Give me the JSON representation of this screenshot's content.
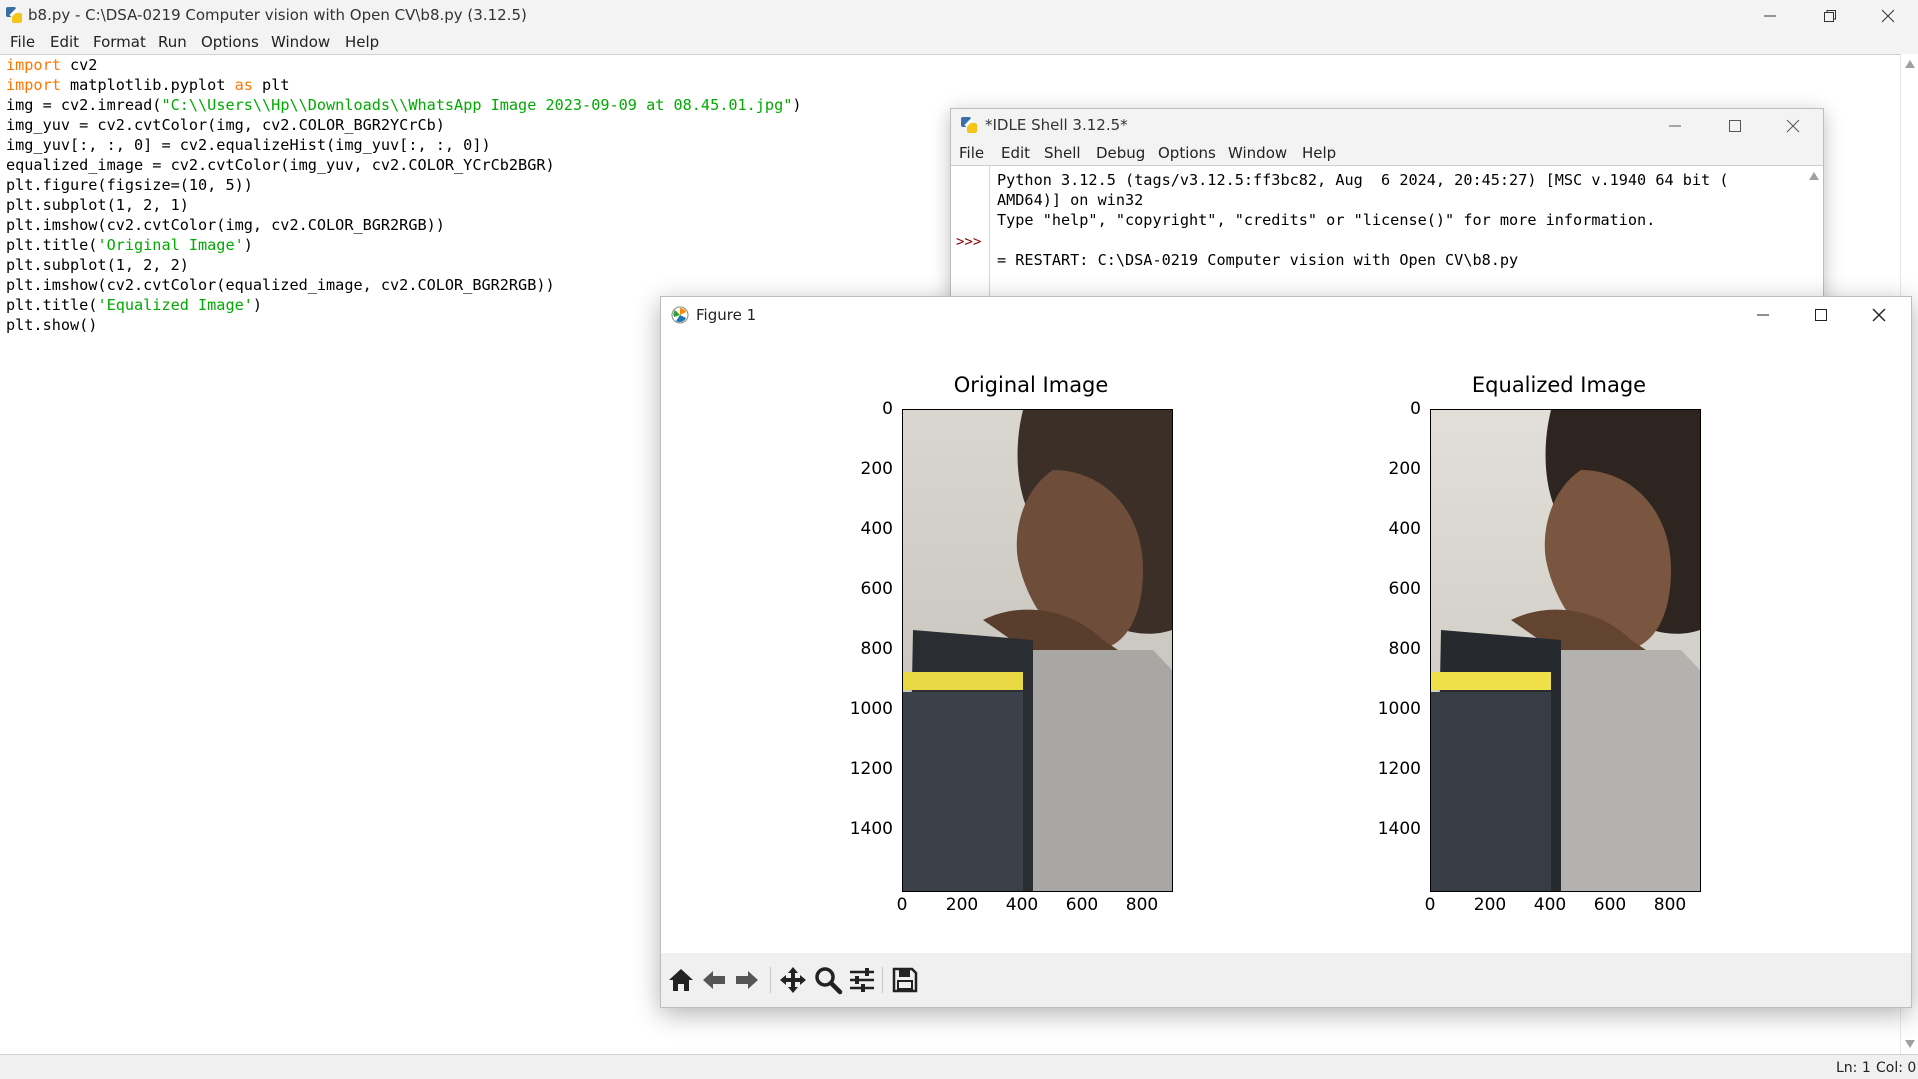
{
  "editor": {
    "title": "b8.py - C:\\DSA-0219 Computer vision with Open CV\\b8.py (3.12.5)",
    "menu": [
      "File",
      "Edit",
      "Format",
      "Run",
      "Options",
      "Window",
      "Help"
    ],
    "code": {
      "l1_kw": "import",
      "l1_rest": " cv2",
      "l2_kw": "import",
      "l2_mid": " matplotlib.pyplot ",
      "l2_kw2": "as",
      "l2_rest": " plt",
      "l3_pre": "img = cv2.imread(",
      "l3_str": "\"C:\\\\Users\\\\Hp\\\\Downloads\\\\WhatsApp Image 2023-09-09 at 08.45.01.jpg\"",
      "l3_post": ")",
      "l4": "img_yuv = cv2.cvtColor(img, cv2.COLOR_BGR2YCrCb)",
      "l5": "img_yuv[:, :, 0] = cv2.equalizeHist(img_yuv[:, :, 0])",
      "l6": "equalized_image = cv2.cvtColor(img_yuv, cv2.COLOR_YCrCb2BGR)",
      "l7": "plt.figure(figsize=(10, 5))",
      "l8": "plt.subplot(1, 2, 1)",
      "l9": "plt.imshow(cv2.cvtColor(img, cv2.COLOR_BGR2RGB))",
      "l10_pre": "plt.title(",
      "l10_str": "'Original Image'",
      "l10_post": ")",
      "l11": "plt.subplot(1, 2, 2)",
      "l12": "plt.imshow(cv2.cvtColor(equalized_image, cv2.COLOR_BGR2RGB))",
      "l13_pre": "plt.title(",
      "l13_str": "'Equalized Image'",
      "l13_post": ")",
      "l14": "plt.show()"
    },
    "status": {
      "line": "Ln: 1",
      "col": "Col: 0"
    }
  },
  "shell": {
    "title": "*IDLE Shell 3.12.5*",
    "menu": [
      "File",
      "Edit",
      "Shell",
      "Debug",
      "Options",
      "Window",
      "Help"
    ],
    "lines": [
      "Python 3.12.5 (tags/v3.12.5:ff3bc82, Aug  6 2024, 20:45:27) [MSC v.1940 64 bit (",
      "AMD64)] on win32",
      "Type \"help\", \"copyright\", \"credits\" or \"license()\" for more information.",
      "",
      "= RESTART: C:\\DSA-0219 Computer vision with Open CV\\b8.py"
    ],
    "prompt": ">>>"
  },
  "figure": {
    "title": "Figure 1",
    "toolbar": [
      "home-icon",
      "back-icon",
      "forward-icon",
      "pan-icon",
      "zoom-icon",
      "configure-subplots-icon",
      "save-icon"
    ],
    "plots": [
      {
        "title": "Original Image",
        "y_ticks": [
          "0",
          "200",
          "400",
          "600",
          "800",
          "1000",
          "1200",
          "1400"
        ],
        "x_ticks": [
          "0",
          "200",
          "400",
          "600",
          "800"
        ]
      },
      {
        "title": "Equalized Image",
        "y_ticks": [
          "0",
          "200",
          "400",
          "600",
          "800",
          "1000",
          "1200",
          "1400"
        ],
        "x_ticks": [
          "0",
          "200",
          "400",
          "600",
          "800"
        ]
      }
    ]
  }
}
